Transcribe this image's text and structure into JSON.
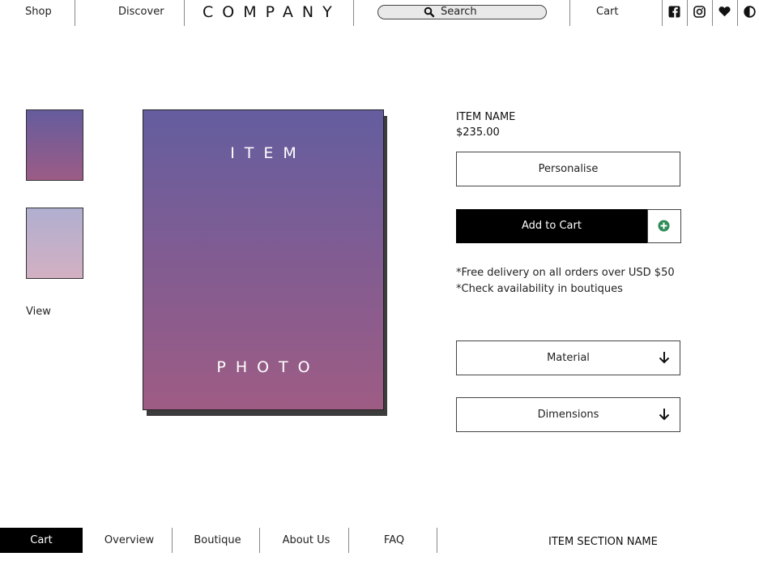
{
  "header": {
    "nav_left": [
      "Shop",
      "Discover"
    ],
    "logo": "COMPANY",
    "search": {
      "label": "Search",
      "icon": "search-icon"
    },
    "cart_label": "Cart",
    "social_icons": [
      "facebook-icon",
      "instagram-icon",
      "heart-icon",
      "contrast-icon"
    ]
  },
  "gallery": {
    "thumbnails": [
      {
        "name": "thumbnail-1",
        "colors": [
          "#655c9d",
          "#9c5c86"
        ]
      },
      {
        "name": "thumbnail-2",
        "colors": [
          "#b0afd0",
          "#d3b0c2"
        ]
      }
    ],
    "view_label": "View",
    "photo_top_text": "ITEM",
    "photo_bottom_text": "PHOTO"
  },
  "product": {
    "name": "ITEM NAME",
    "price": "$235.00",
    "personalise_label": "Personalise",
    "add_to_cart_label": "Add to Cart",
    "notes": [
      "*Free delivery on all orders over USD $50",
      "*Check availability in boutiques"
    ],
    "accordions": [
      {
        "label": "Material"
      },
      {
        "label": "Dimensions"
      }
    ]
  },
  "footer_nav": {
    "items": [
      "Cart",
      "Overview",
      "Boutique",
      "About Us",
      "FAQ"
    ],
    "active": "Cart",
    "section_name": "ITEM SECTION NAME"
  },
  "colors": {
    "accent_black": "#000000",
    "plus_green": "#2e8b57"
  }
}
